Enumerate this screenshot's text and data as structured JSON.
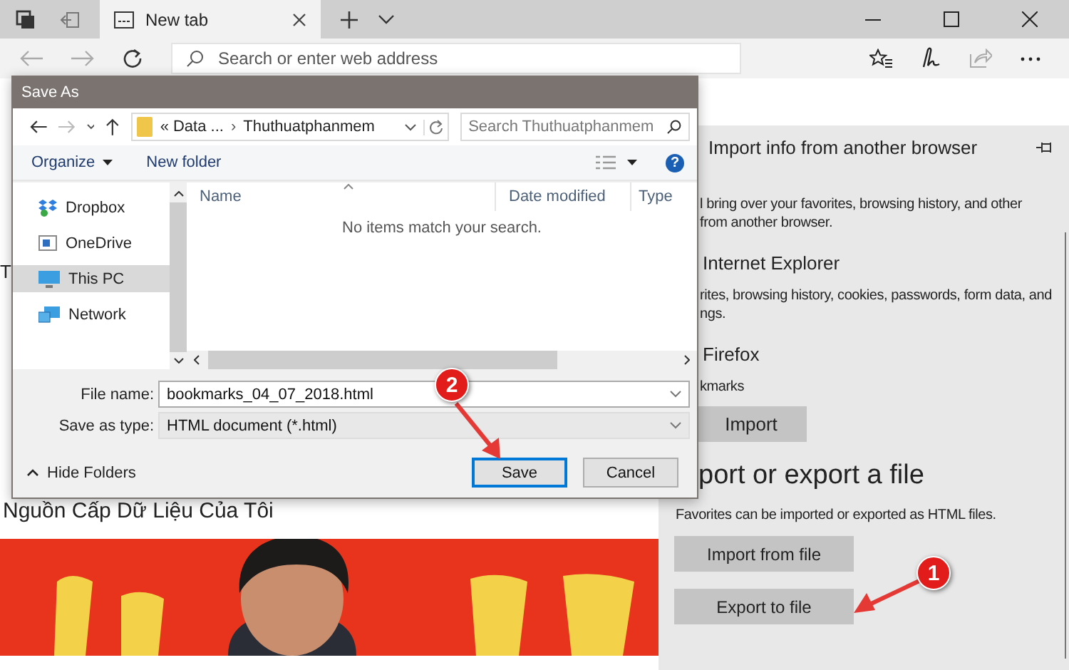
{
  "browser": {
    "tabs": [
      {
        "title": "New tab",
        "selected": true
      }
    ],
    "address_placeholder": "Search or enter web address"
  },
  "page": {
    "heading_fragment": "T",
    "feed_title": "Nguồn Cấp Dữ Liệu Của Tôi"
  },
  "panel": {
    "title": "Import info from another browser",
    "intro": [
      "l bring over your favorites, browsing history, and other",
      "from another browser."
    ],
    "sources": [
      {
        "name": "Internet Explorer",
        "details": [
          "rites, browsing history, cookies, passwords, form data, and",
          "ngs."
        ]
      },
      {
        "name": "Firefox",
        "details": [
          "kmarks"
        ]
      }
    ],
    "import_button": "Import",
    "export_title": "port or export a file",
    "export_description": "Favorites can be imported or exported as HTML files.",
    "export_buttons": [
      "Import from file",
      "Export to file"
    ]
  },
  "dialog": {
    "title": "Save As",
    "path": {
      "prefix": "«",
      "separator": "›",
      "parts": [
        "Data ...",
        "Thuthuatphanmem"
      ]
    },
    "search_placeholder": "Search Thuthuatphanmem",
    "toolbar": [
      {
        "label": "Organize",
        "kind": "menu"
      },
      {
        "label": "New folder",
        "kind": "button"
      }
    ],
    "help": "?",
    "nav": [
      {
        "name": "Dropbox",
        "kind": "dropbox",
        "selected": false
      },
      {
        "name": "OneDrive",
        "kind": "onedrive",
        "selected": false
      },
      {
        "name": "This PC",
        "kind": "pc",
        "selected": true
      },
      {
        "name": "Network",
        "kind": "network",
        "selected": false
      }
    ],
    "columns": [
      "Name",
      "Date modified",
      "Type"
    ],
    "empty_message": "No items match your search.",
    "file_name_label": "File name:",
    "file_name": "bookmarks_04_07_2018.html",
    "type_label": "Save as type:",
    "file_type": "HTML document (*.html)",
    "hide_folders": "Hide Folders",
    "buttons": [
      {
        "label": "Save",
        "default": true
      },
      {
        "label": "Cancel",
        "default": false
      }
    ]
  },
  "callouts": [
    {
      "label": "2"
    },
    {
      "label": "1"
    }
  ]
}
